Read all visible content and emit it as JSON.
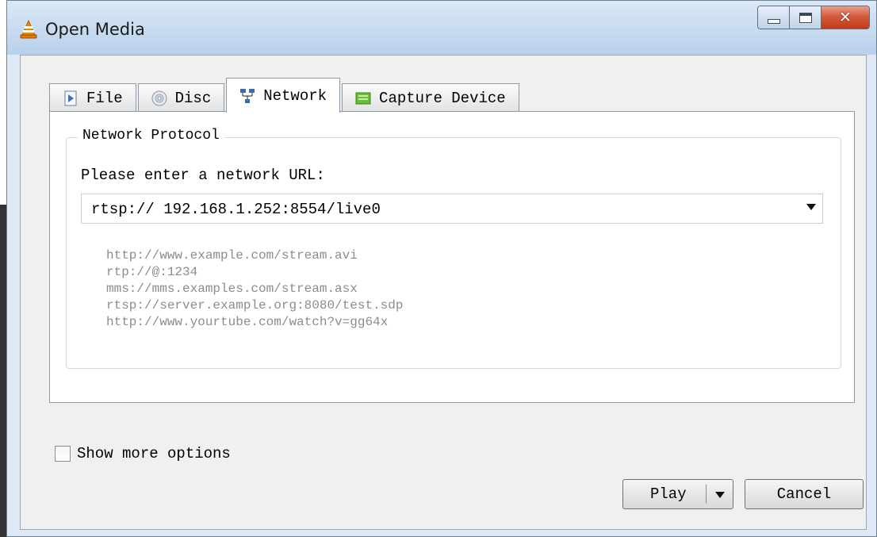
{
  "window": {
    "title": "Open Media",
    "icon": "vlc-cone-icon",
    "caption_buttons": {
      "minimize": "minimize-icon",
      "maximize": "maximize-icon",
      "close": "close-icon"
    }
  },
  "tabs": [
    {
      "label": "File",
      "icon": "file-icon",
      "active": false
    },
    {
      "label": "Disc",
      "icon": "disc-icon",
      "active": false
    },
    {
      "label": "Network",
      "icon": "network-icon",
      "active": true
    },
    {
      "label": "Capture Device",
      "icon": "capture-device-icon",
      "active": false
    }
  ],
  "network": {
    "group_title": "Network Protocol",
    "url_prompt": "Please enter a network URL:",
    "url_value": "rtsp:// 192.168.1.252:8554/live0",
    "examples": [
      "http://www.example.com/stream.avi",
      "rtp://@:1234",
      "mms://mms.examples.com/stream.asx",
      "rtsp://server.example.org:8080/test.sdp",
      "http://www.yourtube.com/watch?v=gg64x"
    ]
  },
  "options": {
    "show_more_label": "Show more options",
    "show_more_checked": false
  },
  "buttons": {
    "play": "Play",
    "cancel": "Cancel"
  },
  "colors": {
    "title_bar": "#c9dcf1",
    "close_button": "#c13a1a",
    "example_text": "#8c8c8c"
  }
}
